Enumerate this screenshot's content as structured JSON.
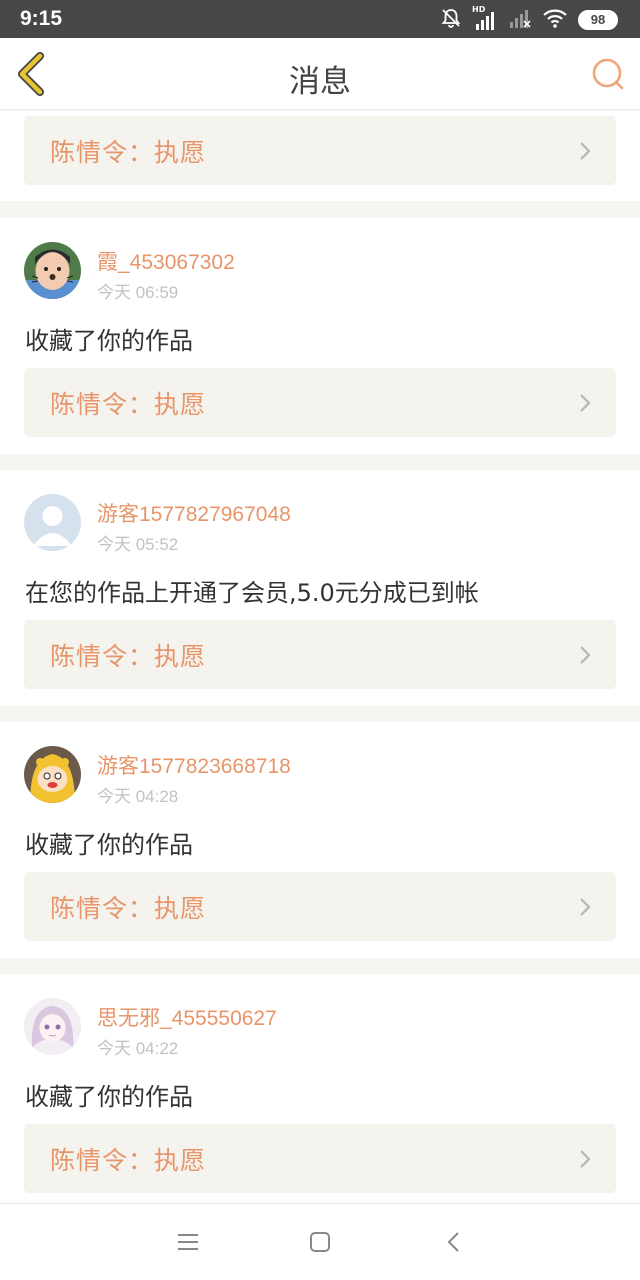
{
  "status_bar": {
    "time": "9:15",
    "battery": "98",
    "network_label": "HD"
  },
  "header": {
    "title": "消息"
  },
  "messages": [
    {
      "ref": "陈情令：执愿"
    },
    {
      "user": "霞_453067302",
      "time": "今天 06:59",
      "text": "收藏了你的作品",
      "ref": "陈情令：执愿"
    },
    {
      "user": "游客1577827967048",
      "time": "今天 05:52",
      "text": "在您的作品上开通了会员,5.0元分成已到帐",
      "ref": "陈情令：执愿"
    },
    {
      "user": "游客1577823668718",
      "time": "今天 04:28",
      "text": "收藏了你的作品",
      "ref": "陈情令：执愿"
    },
    {
      "user": "思无邪_455550627",
      "time": "今天 04:22",
      "text": "收藏了你的作品",
      "ref": "陈情令：执愿"
    }
  ],
  "colors": {
    "accent": "#e8956a",
    "back_arrow": "#e8c431",
    "status_bar": "#474747",
    "ref_bg": "#f4f3ee"
  },
  "icons": {
    "back": "back-arrow-icon",
    "search": "search-icon",
    "chevron": "chevron-right-icon",
    "menu": "menu-icon",
    "home": "home-square-icon",
    "nav_back": "nav-back-icon"
  }
}
